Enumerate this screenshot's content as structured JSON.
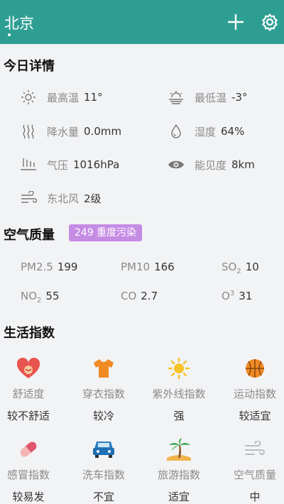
{
  "header": {
    "city": "北京",
    "add_icon": "plus-icon",
    "settings_icon": "gear-icon"
  },
  "today": {
    "title": "今日详情",
    "items": [
      {
        "icon": "sun-icon",
        "label": "最高温",
        "value": "11°"
      },
      {
        "icon": "sunset-icon",
        "label": "最低温",
        "value": "-3°"
      },
      {
        "icon": "rain-icon",
        "label": "降水量",
        "value": "0.0mm"
      },
      {
        "icon": "drop-icon",
        "label": "湿度",
        "value": "64%"
      },
      {
        "icon": "pressure-icon",
        "label": "气压",
        "value": "1016hPa"
      },
      {
        "icon": "eye-icon",
        "label": "能见度",
        "value": "8km"
      },
      {
        "icon": "wind-icon",
        "label": "东北风",
        "value": "2级"
      }
    ]
  },
  "air": {
    "title": "空气质量",
    "badge": "249 重度污染",
    "badge_color": "#c58ce4",
    "items": [
      {
        "label": "PM2.5",
        "value": "199"
      },
      {
        "label": "PM10",
        "value": "166"
      },
      {
        "label": "SO",
        "sub": "2",
        "value": "10"
      },
      {
        "label": "NO",
        "sub": "2",
        "value": "55"
      },
      {
        "label": "CO",
        "value": "2.7"
      },
      {
        "label": "O",
        "sup": "3",
        "value": "31"
      }
    ]
  },
  "life": {
    "title": "生活指数",
    "items": [
      {
        "icon": "heart-icon",
        "name": "舒适度",
        "value": "较不舒适"
      },
      {
        "icon": "tshirt-icon",
        "name": "穿衣指数",
        "value": "较冷"
      },
      {
        "icon": "sun-icon",
        "name": "紫外线指数",
        "value": "强"
      },
      {
        "icon": "basketball-icon",
        "name": "运动指数",
        "value": "较适宜"
      },
      {
        "icon": "pill-icon",
        "name": "感冒指数",
        "value": "较易发"
      },
      {
        "icon": "car-icon",
        "name": "洗车指数",
        "value": "不宜"
      },
      {
        "icon": "palm-tree-icon",
        "name": "旅游指数",
        "value": "适宜"
      },
      {
        "icon": "wind-icon",
        "name": "空气质量",
        "value": "中"
      }
    ]
  },
  "colors": {
    "header": "#2e9e93",
    "background": "#f2f3f5",
    "label": "#8a8a8a"
  }
}
